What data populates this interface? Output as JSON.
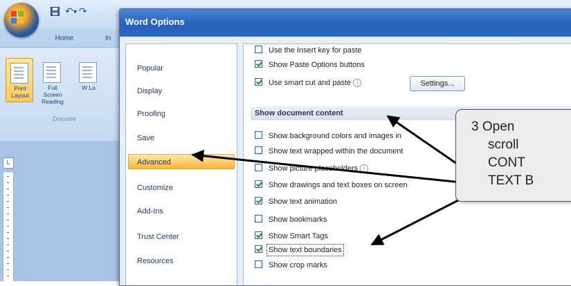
{
  "word": {
    "tabs": {
      "home": "Home",
      "insert": "In"
    },
    "buttons": {
      "print_layout": "Print Layout",
      "full_screen": "Full Screen Reading",
      "web": "W La"
    },
    "group_label": "Docume",
    "ruler_corner": "L"
  },
  "dialog": {
    "title": "Word Options",
    "nav": [
      "Popular",
      "Display",
      "Proofing",
      "Save",
      "Advanced",
      "Customize",
      "Add-Ins",
      "Trust Center",
      "Resources"
    ],
    "selected_nav": "Advanced",
    "options_top": [
      {
        "label": "Use the Insert key for paste",
        "checked": false
      },
      {
        "label": "Show Paste Options buttons",
        "checked": true
      },
      {
        "label": "Use smart cut and paste",
        "checked": true
      }
    ],
    "settings_label": "Settings...",
    "section_header": "Show document content",
    "options_content": [
      {
        "label": "Show background colors and images in",
        "checked": false
      },
      {
        "label": "Show text wrapped within the document",
        "checked": false
      },
      {
        "label": "Show picture placeholders",
        "checked": false
      },
      {
        "label": "Show drawings and text boxes on screen",
        "checked": true
      },
      {
        "label": "Show text animation",
        "checked": true
      },
      {
        "label": "Show bookmarks",
        "checked": false
      },
      {
        "label": "Show Smart Tags",
        "checked": true
      },
      {
        "label": "Show text boundaries",
        "checked": true
      },
      {
        "label": "Show crop marks",
        "checked": false
      }
    ]
  },
  "callout": {
    "lines": [
      "3  Open",
      "scroll",
      "CONT",
      "TEXT B"
    ]
  }
}
